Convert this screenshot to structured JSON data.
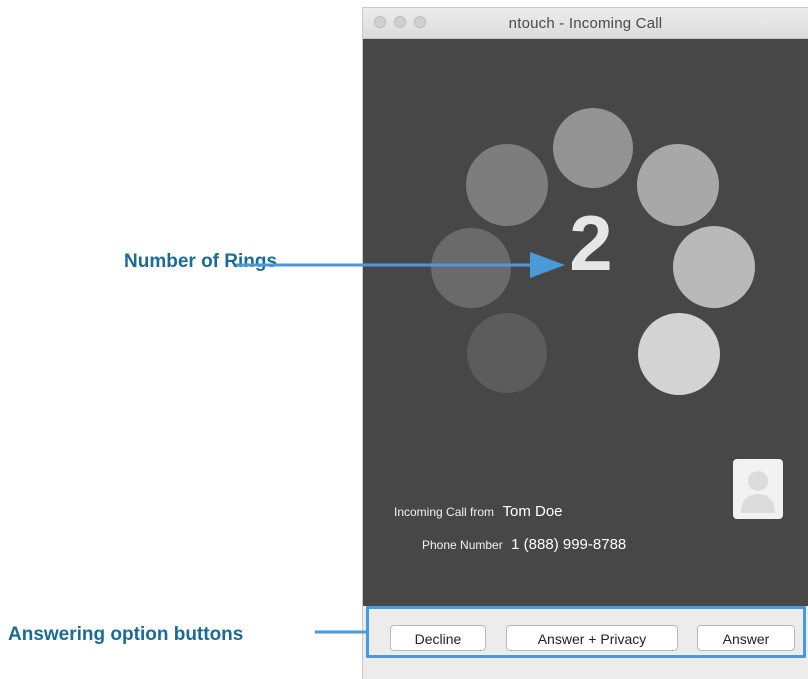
{
  "window": {
    "title": "ntouch - Incoming Call"
  },
  "ring": {
    "count": "2"
  },
  "caller": {
    "from_label": "Incoming Call from",
    "name": "Tom Doe",
    "phone_label": "Phone Number",
    "phone": "1 (888) 999-8788"
  },
  "avatar": {
    "icon": "person-silhouette-icon"
  },
  "buttons": {
    "decline": "Decline",
    "answer_privacy": "Answer + Privacy",
    "answer": "Answer"
  },
  "annotations": {
    "rings": "Number of Rings",
    "buttons": "Answering option buttons"
  },
  "colors": {
    "panel_background": "#474747",
    "annotation_text": "#1b6c90",
    "annotation_line": "#4a9ad9"
  }
}
